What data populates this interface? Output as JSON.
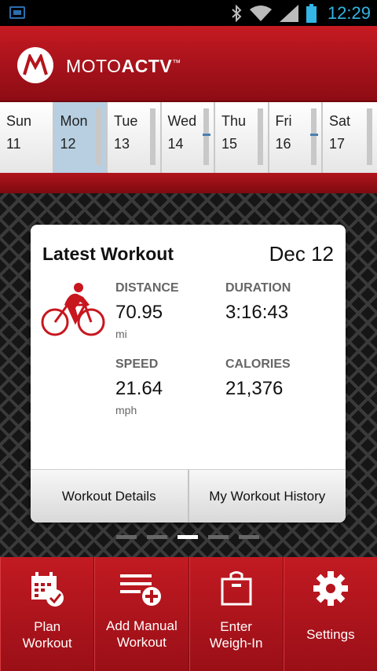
{
  "status_bar": {
    "time": "12:29",
    "icons": [
      "notification-icon",
      "bluetooth-icon",
      "wifi-icon",
      "signal-icon",
      "battery-icon"
    ]
  },
  "header": {
    "brand_light": "MOTO",
    "brand_bold": "ACTV",
    "trademark": "™",
    "accent_color": "#b5141c"
  },
  "calendar": {
    "days": [
      {
        "name": "Sun",
        "num": "11"
      },
      {
        "name": "Mon",
        "num": "12"
      },
      {
        "name": "Tue",
        "num": "13"
      },
      {
        "name": "Wed",
        "num": "14"
      },
      {
        "name": "Thu",
        "num": "15"
      },
      {
        "name": "Fri",
        "num": "16"
      },
      {
        "name": "Sat",
        "num": "17"
      }
    ],
    "selected_index": 1
  },
  "workout_card": {
    "title": "Latest Workout",
    "date": "Dec 12",
    "activity_icon": "cycling-icon",
    "distance": {
      "label": "DISTANCE",
      "value": "70.95",
      "unit": "mi"
    },
    "duration": {
      "label": "DURATION",
      "value": "3:16:43"
    },
    "speed": {
      "label": "SPEED",
      "value": "21.64",
      "unit": "mph"
    },
    "calories": {
      "label": "CALORIES",
      "value": "21,376"
    },
    "buttons": {
      "details": "Workout Details",
      "history": "My Workout History"
    }
  },
  "pager": {
    "count": 5,
    "active_index": 2
  },
  "toolbar": {
    "plan": {
      "line1": "Plan",
      "line2": "Workout"
    },
    "manual": {
      "line1": "Add Manual",
      "line2": "Workout"
    },
    "weigh": {
      "line1": "Enter",
      "line2": "Weigh-In"
    },
    "settings": {
      "line1": "Settings"
    }
  }
}
